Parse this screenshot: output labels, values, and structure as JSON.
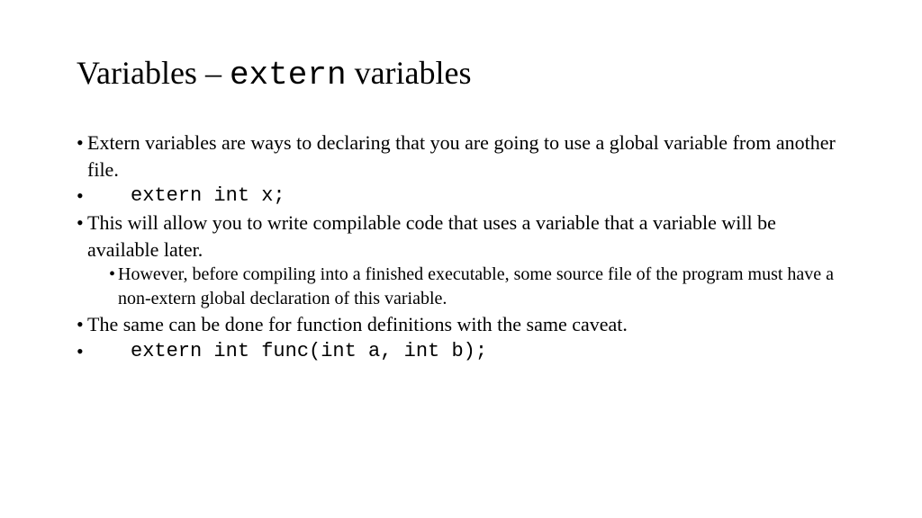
{
  "title": {
    "part1": "Variables",
    "dash": " – ",
    "code": "extern",
    "part2": " variables"
  },
  "bullets": {
    "b1": "Extern variables are ways to declaring that you are going to use a global variable from another file.",
    "b2_code": "extern int x;",
    "b3": "This will allow you to write compilable code that uses a variable that a variable will be available later.",
    "b3_sub": "However, before compiling into a finished executable, some source file of the program must have a non-extern global declaration of this variable.",
    "b4": "The same can be done for function definitions with the same caveat.",
    "b5_code": "extern int func(int a, int b);"
  }
}
